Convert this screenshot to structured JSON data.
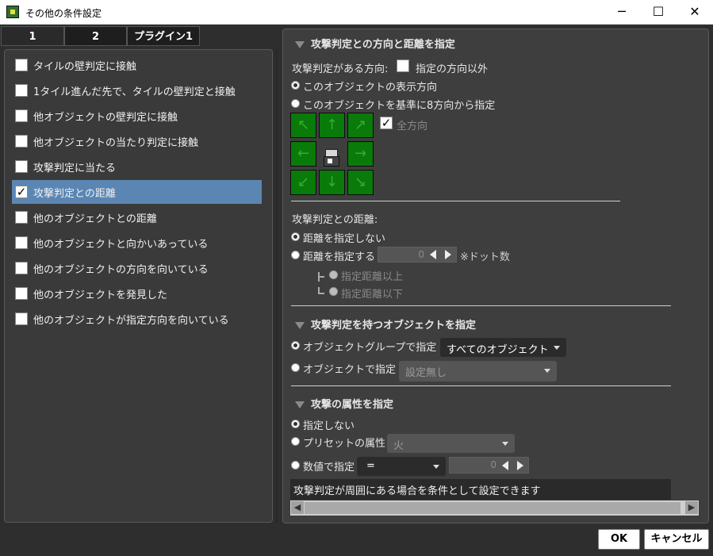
{
  "window": {
    "title": "その他の条件設定",
    "minimize": "─",
    "maximize": "☐",
    "close": "✕"
  },
  "tabs": [
    {
      "label": "1"
    },
    {
      "label": "2"
    },
    {
      "label": "プラグイン1"
    }
  ],
  "conditions": [
    {
      "label": "タイルの壁判定に接触",
      "checked": false
    },
    {
      "label": "1タイル進んだ先で、タイルの壁判定と接触",
      "checked": false
    },
    {
      "label": "他オブジェクトの壁判定に接触",
      "checked": false
    },
    {
      "label": "他オブジェクトの当たり判定に接触",
      "checked": false
    },
    {
      "label": "攻撃判定に当たる",
      "checked": false
    },
    {
      "label": "攻撃判定との距離",
      "checked": true
    },
    {
      "label": "他のオブジェクトとの距離",
      "checked": false
    },
    {
      "label": "他のオブジェクトと向かいあっている",
      "checked": false
    },
    {
      "label": "他のオブジェクトの方向を向いている",
      "checked": false
    },
    {
      "label": "他のオブジェクトを発見した",
      "checked": false
    },
    {
      "label": "他のオブジェクトが指定方向を向いている",
      "checked": false
    }
  ],
  "checkmark": "✓",
  "direction": {
    "header": "攻撃判定との方向と距離を指定",
    "label": "攻撃判定がある方向:",
    "except_label": "指定の方向以外",
    "option_display": "このオブジェクトの表示方向",
    "option_8dir": "このオブジェクトを基準に8方向から指定",
    "all_dirs_label": "全方向",
    "arrows": [
      "↖",
      "↑",
      "↗",
      "←",
      "→",
      "↙",
      "↓",
      "↘"
    ]
  },
  "distance": {
    "label": "攻撃判定との距離:",
    "option_none": "距離を指定しない",
    "option_specify": "距離を指定する",
    "value": "0",
    "unit": "※ドット数",
    "above": "指定距離以上",
    "below": "指定距離以下"
  },
  "object": {
    "header": "攻撃判定を持つオブジェクトを指定",
    "group_label": "オブジェクトグループで指定",
    "group_value": "すべてのオブジェクト",
    "object_label": "オブジェクトで指定",
    "object_value": "設定無し"
  },
  "attribute": {
    "header": "攻撃の属性を指定",
    "option_none": "指定しない",
    "preset_label": "プリセットの属性",
    "preset_value": "火",
    "numeric_label": "数値で指定",
    "operator_value": "=",
    "numeric_value": "0"
  },
  "description": "攻撃判定が周囲にある場合を条件として設定できます",
  "buttons": {
    "ok": "OK",
    "cancel": "キャンセル"
  }
}
